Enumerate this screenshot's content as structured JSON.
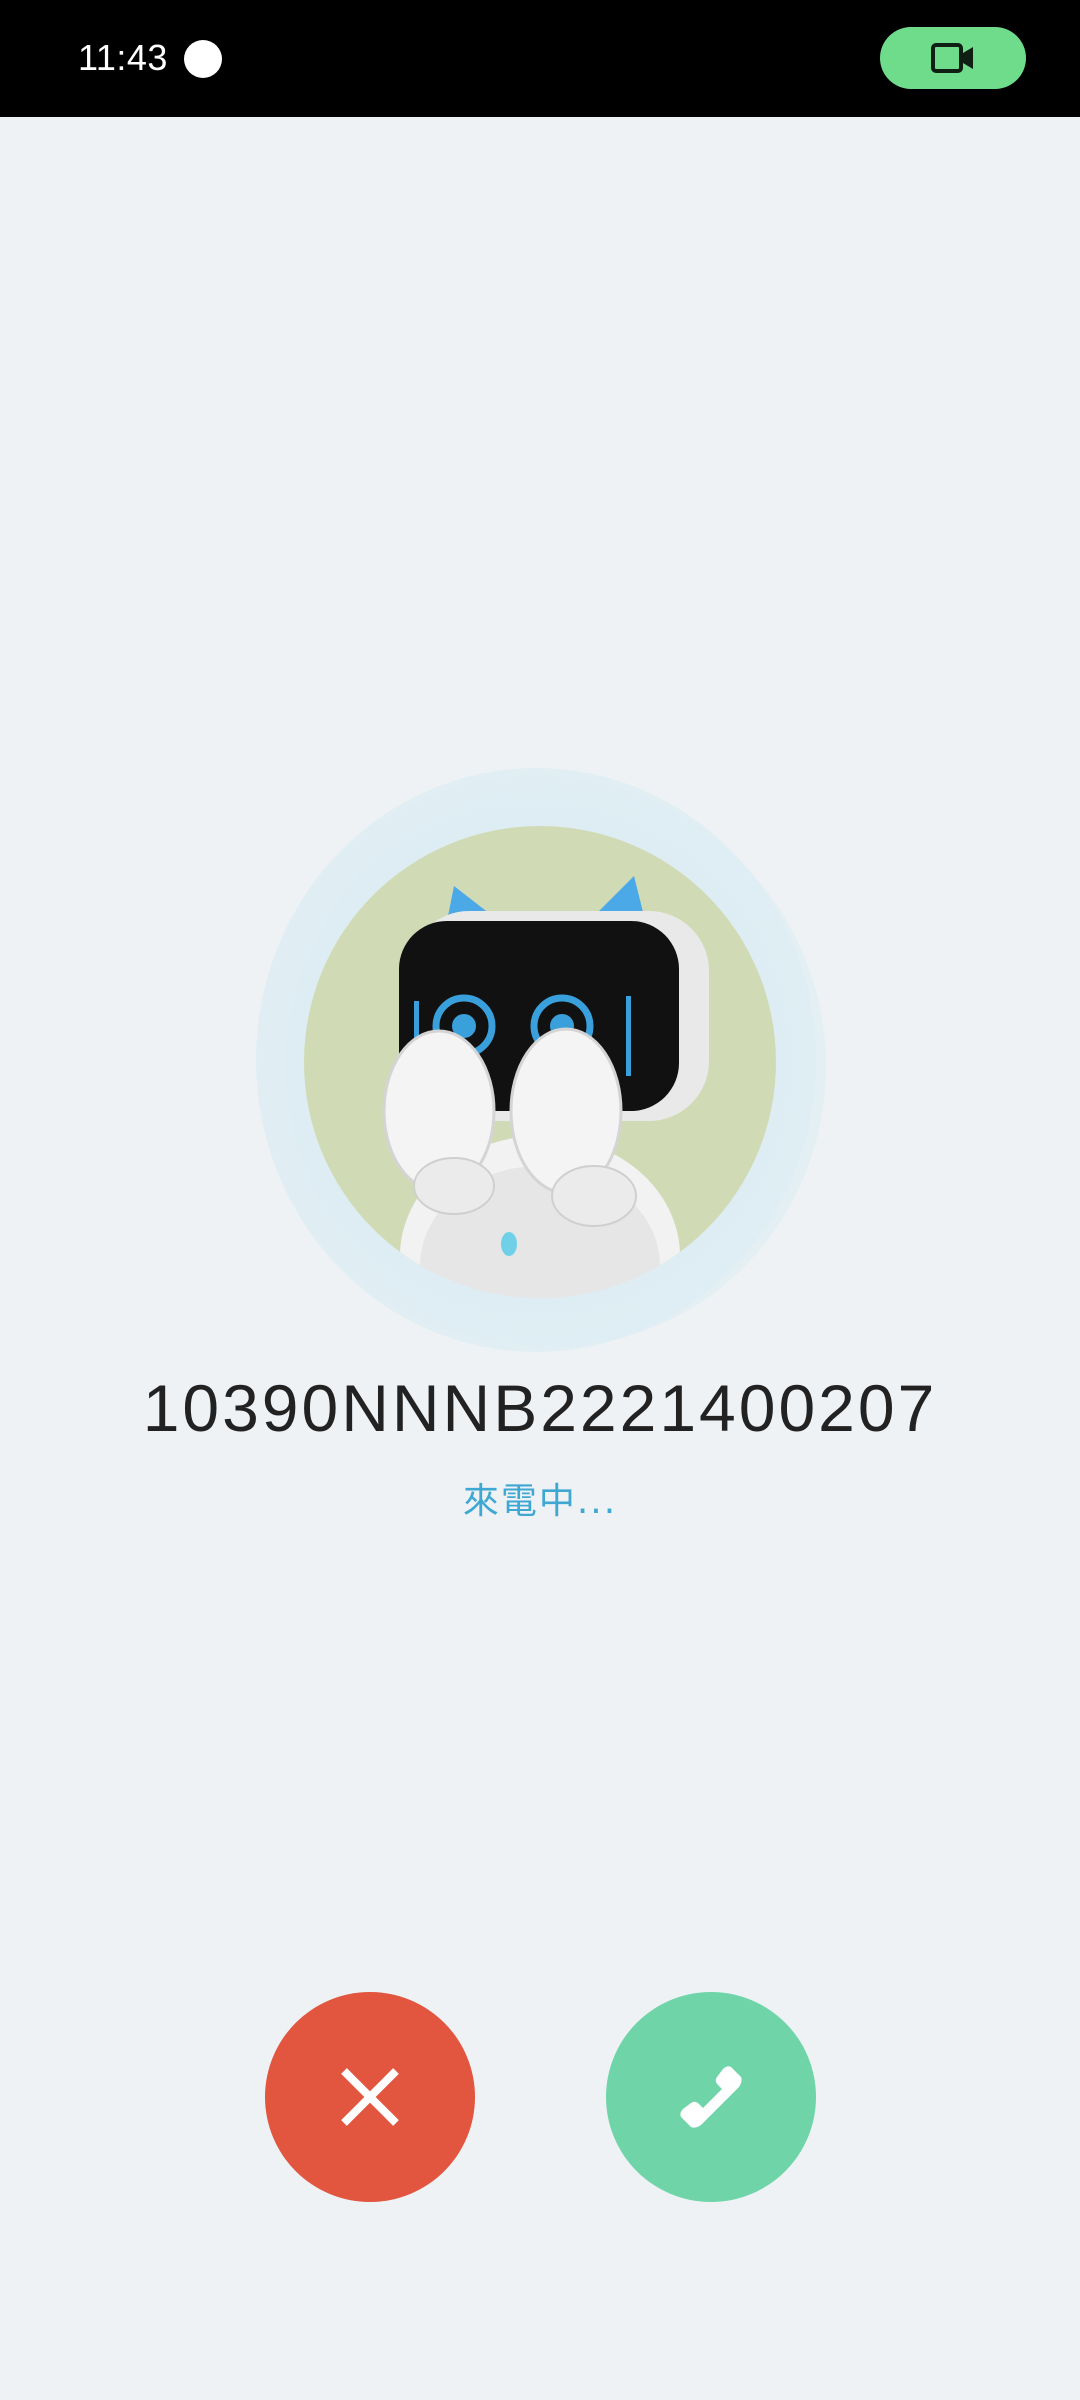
{
  "status_bar": {
    "time": "11:43",
    "indicator_icon": "circle-dot-icon",
    "recording_pill": {
      "icon": "video-camera-icon",
      "color": "#6fdc8c"
    },
    "background": "#000000"
  },
  "caller": {
    "avatar_icon": "robot-cat-avatar",
    "avatar_bg": "#d0dbb6",
    "name": "10390NNNB2221400207",
    "status": "來電中..."
  },
  "actions": {
    "decline": {
      "icon": "close-icon",
      "color": "#e2553f"
    },
    "accept": {
      "icon": "phone-icon",
      "color": "#6fd5a9"
    }
  },
  "colors": {
    "page_background": "#eef2f5",
    "status_text": "#3fa8d2",
    "name_text": "#222222"
  }
}
